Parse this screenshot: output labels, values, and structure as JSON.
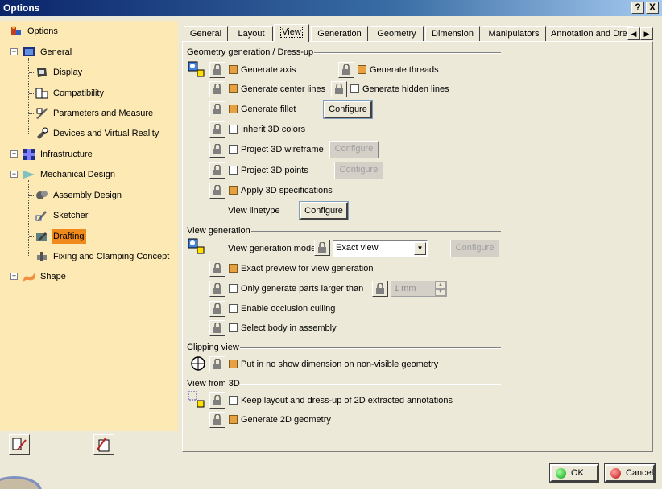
{
  "window": {
    "title": "Options",
    "help_label": "?",
    "close_label": "X"
  },
  "tree": {
    "items": [
      {
        "label": "Options",
        "icon": "options-tree-icon"
      },
      {
        "label": "General",
        "icon": "general-icon"
      },
      {
        "label": "Display",
        "icon": "display-icon"
      },
      {
        "label": "Compatibility",
        "icon": "compatibility-icon"
      },
      {
        "label": "Parameters and Measure",
        "icon": "parameters-icon"
      },
      {
        "label": "Devices and Virtual Reality",
        "icon": "devices-icon"
      },
      {
        "label": "Infrastructure",
        "icon": "infrastructure-icon"
      },
      {
        "label": "Mechanical Design",
        "icon": "mechanical-design-icon"
      },
      {
        "label": "Assembly Design",
        "icon": "assembly-icon"
      },
      {
        "label": "Sketcher",
        "icon": "sketcher-icon"
      },
      {
        "label": "Drafting",
        "icon": "drafting-icon",
        "selected": true
      },
      {
        "label": "Fixing and Clamping Concept",
        "icon": "fixing-icon"
      },
      {
        "label": "Shape",
        "icon": "shape-icon"
      }
    ]
  },
  "tabs": [
    {
      "label": "General"
    },
    {
      "label": "Layout"
    },
    {
      "label": "View",
      "active": true
    },
    {
      "label": "Generation"
    },
    {
      "label": "Geometry"
    },
    {
      "label": "Dimension"
    },
    {
      "label": "Manipulators"
    },
    {
      "label": "Annotation and Dress-up"
    }
  ],
  "sections": {
    "geometry": {
      "title": "Geometry generation / Dress-up",
      "generate_axis": "Generate axis",
      "generate_threads": "Generate threads",
      "generate_center_lines": "Generate center lines",
      "generate_hidden_lines": "Generate hidden lines",
      "generate_fillet": "Generate fillet",
      "inherit_3d_colors": "Inherit 3D colors",
      "project_3d_wireframe": "Project 3D wireframe",
      "project_3d_points": "Project 3D points",
      "apply_3d_specifications": "Apply 3D specifications",
      "view_linetype": "View linetype",
      "configure": "Configure"
    },
    "view_generation": {
      "title": "View generation",
      "mode_label": "View generation mode",
      "mode_value": "Exact view",
      "configure": "Configure",
      "exact_preview": "Exact preview for view generation",
      "only_larger": "Only generate parts larger than",
      "size_value": "1 mm",
      "occlusion": "Enable occlusion culling",
      "select_body": "Select body in assembly"
    },
    "clipping": {
      "title": "Clipping view",
      "no_show": "Put in no show dimension on non-visible geometry"
    },
    "view_from_3d": {
      "title": "View from 3D",
      "keep_layout": "Keep layout and dress-up of 2D extracted annotations",
      "generate_2d": "Generate 2D geometry"
    }
  },
  "footer": {
    "ok": "OK",
    "cancel": "Cancel"
  },
  "colors": {
    "tree_bg": "#fde9b4",
    "selected": "#f08a1c",
    "checked": "#e8a040"
  }
}
